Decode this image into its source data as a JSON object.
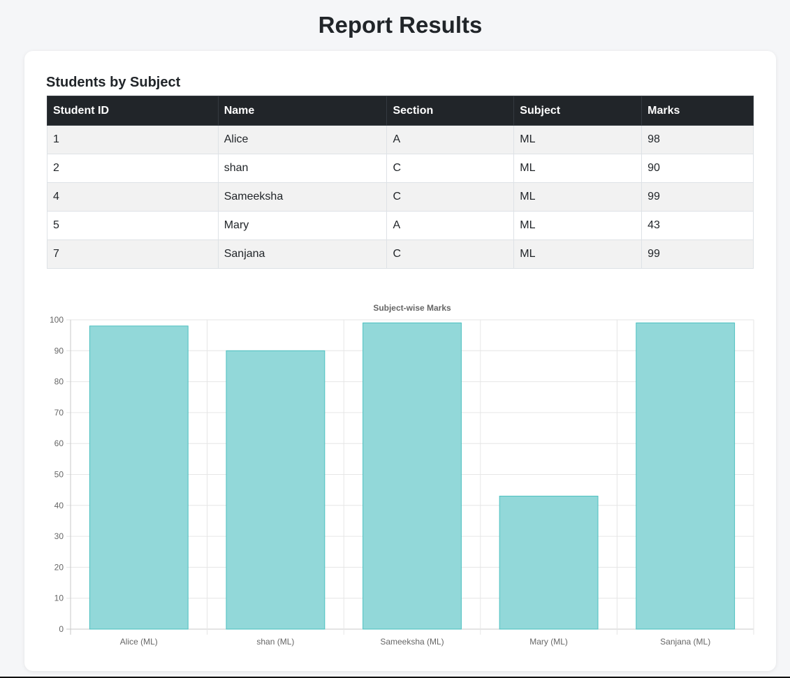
{
  "page": {
    "title": "Report Results"
  },
  "section": {
    "heading": "Students by Subject"
  },
  "table": {
    "columns": [
      "Student ID",
      "Name",
      "Section",
      "Subject",
      "Marks"
    ],
    "rows": [
      [
        "1",
        "Alice",
        "A",
        "ML",
        "98"
      ],
      [
        "2",
        "shan",
        "C",
        "ML",
        "90"
      ],
      [
        "4",
        "Sameeksha",
        "C",
        "ML",
        "99"
      ],
      [
        "5",
        "Mary",
        "A",
        "ML",
        "43"
      ],
      [
        "7",
        "Sanjana",
        "C",
        "ML",
        "99"
      ]
    ]
  },
  "chart_data": {
    "type": "bar",
    "title": "Subject-wise Marks",
    "xlabel": "",
    "ylabel": "",
    "categories": [
      "Alice (ML)",
      "shan (ML)",
      "Sameeksha (ML)",
      "Mary (ML)",
      "Sanjana (ML)"
    ],
    "values": [
      98,
      90,
      99,
      43,
      99
    ],
    "ylim": [
      0,
      100
    ],
    "yticks": [
      0,
      10,
      20,
      30,
      40,
      50,
      60,
      70,
      80,
      90,
      100
    ],
    "grid": true,
    "legend": "none",
    "bar_fill": "#92d8d9",
    "bar_stroke": "#4bc0c0"
  }
}
